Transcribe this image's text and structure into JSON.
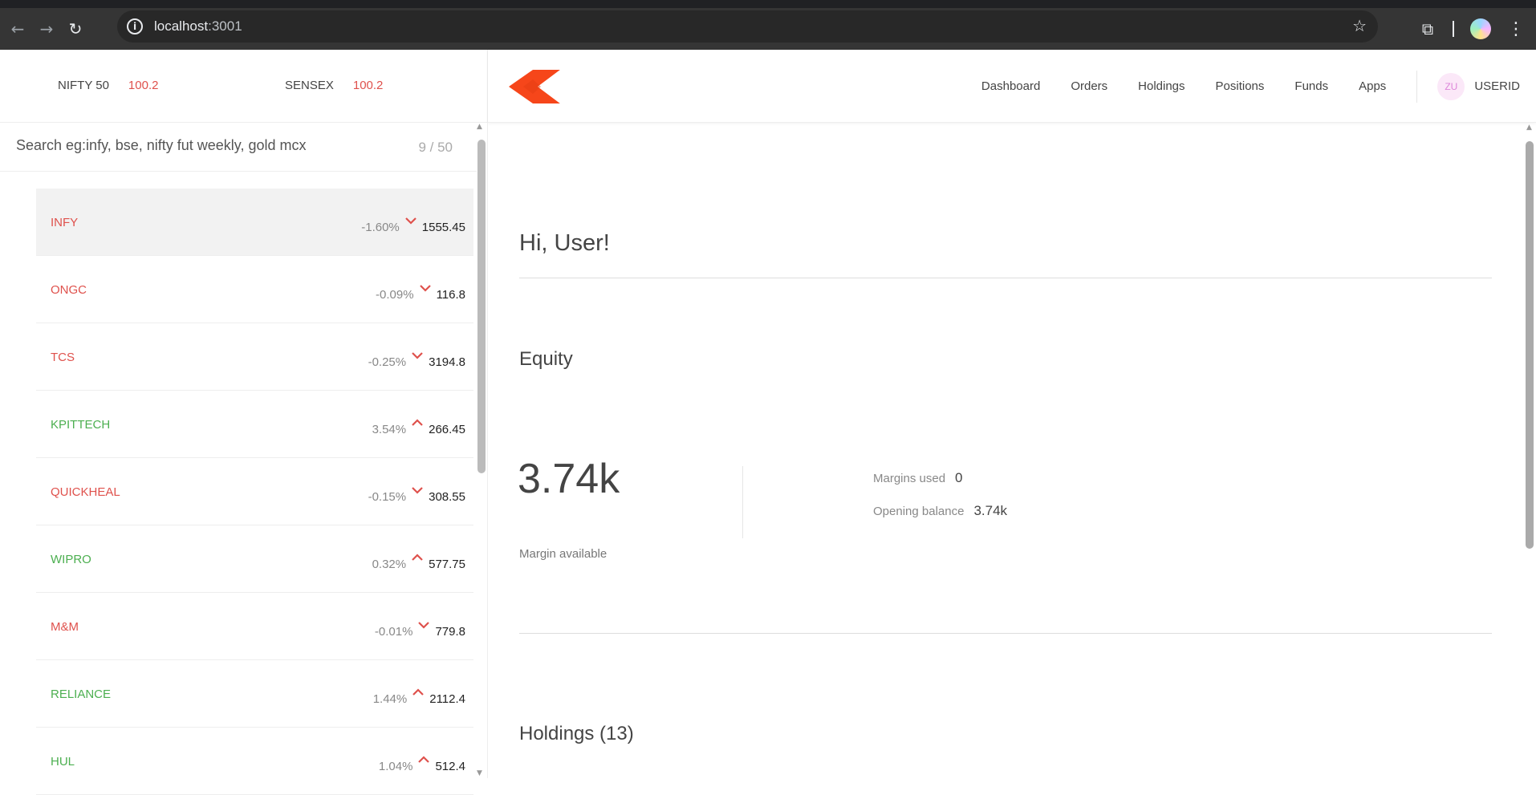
{
  "browser": {
    "url_host": "localhost",
    "url_port": ":3001"
  },
  "indices": [
    {
      "name": "NIFTY 50",
      "value": "100.2"
    },
    {
      "name": "SENSEX",
      "value": "100.2"
    }
  ],
  "nav": {
    "items": [
      "Dashboard",
      "Orders",
      "Holdings",
      "Positions",
      "Funds",
      "Apps"
    ],
    "avatar": "ZU",
    "user": "USERID"
  },
  "watchlist": {
    "search_placeholder": "Search eg:infy, bse, nifty fut weekly, gold mcx",
    "count": "9 / 50",
    "items": [
      {
        "name": "INFY",
        "pct": "-1.60%",
        "price": "1555.45",
        "dir": "down"
      },
      {
        "name": "ONGC",
        "pct": "-0.09%",
        "price": "116.8",
        "dir": "down"
      },
      {
        "name": "TCS",
        "pct": "-0.25%",
        "price": "3194.8",
        "dir": "down"
      },
      {
        "name": "KPITTECH",
        "pct": "3.54%",
        "price": "266.45",
        "dir": "up"
      },
      {
        "name": "QUICKHEAL",
        "pct": "-0.15%",
        "price": "308.55",
        "dir": "down"
      },
      {
        "name": "WIPRO",
        "pct": "0.32%",
        "price": "577.75",
        "dir": "up"
      },
      {
        "name": "M&M",
        "pct": "-0.01%",
        "price": "779.8",
        "dir": "down"
      },
      {
        "name": "RELIANCE",
        "pct": "1.44%",
        "price": "2112.4",
        "dir": "up"
      },
      {
        "name": "HUL",
        "pct": "1.04%",
        "price": "512.4",
        "dir": "up"
      }
    ]
  },
  "main": {
    "greeting": "Hi, User!",
    "equity_title": "Equity",
    "margin_available_value": "3.74k",
    "margin_available_label": "Margin available",
    "margins_used_label": "Margins used",
    "margins_used_value": "0",
    "opening_balance_label": "Opening balance",
    "opening_balance_value": "3.74k",
    "holdings_title": "Holdings (13)"
  },
  "colors": {
    "down": "#df514c",
    "up": "#4caf50",
    "logo": "#f6461a"
  }
}
